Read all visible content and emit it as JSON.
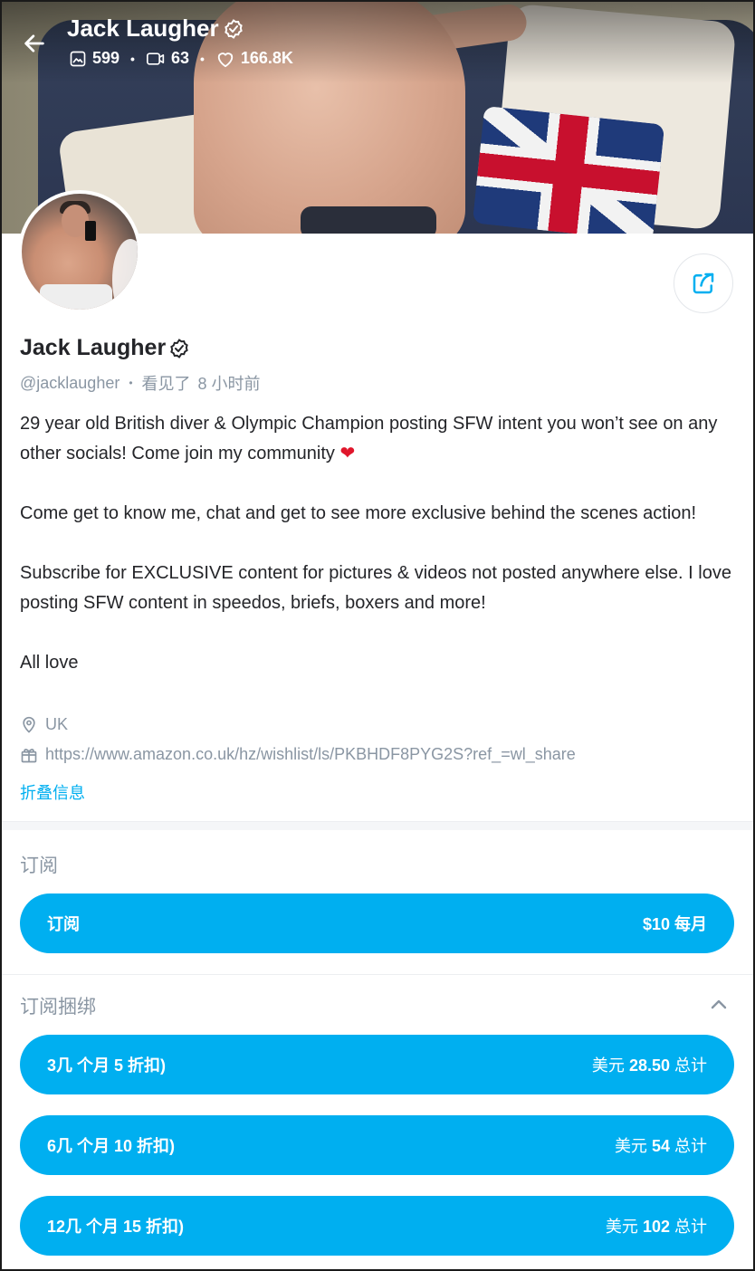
{
  "header": {
    "title": "Jack Laugher",
    "stats": {
      "photos": "599",
      "videos": "63",
      "likes": "166.8K"
    }
  },
  "profile": {
    "name": "Jack Laugher",
    "handle": "@jacklaugher",
    "seen_label": "看见了",
    "seen_time": "8 小时前"
  },
  "bio": {
    "p1": "29 year old British diver & Olympic Champion posting SFW intent you won’t see on any other socials! Come join my community",
    "p2": "Come get to know me, chat and get to see more exclusive behind the scenes action!",
    "p3": "Subscribe for EXCLUSIVE content for pictures & videos not posted anywhere else. I love posting SFW content in speedos, briefs, boxers and more!",
    "p4": "All love",
    "location": "UK",
    "wishlist_url": "https://www.amazon.co.uk/hz/wishlist/ls/PKBHDF8PYG2S?ref_=wl_share",
    "collapse_label": "折叠信息"
  },
  "subscription": {
    "section_label": "订阅",
    "button_label": "订阅",
    "price": "$10",
    "period": "每月"
  },
  "bundles": {
    "section_label": "订阅捆绑",
    "items": [
      {
        "label": "3几 个月 5 折扣)",
        "prefix": "美元",
        "amount": "28.50",
        "suffix": "总计"
      },
      {
        "label": "6几 个月 10 折扣)",
        "prefix": "美元",
        "amount": "54",
        "suffix": "总计"
      },
      {
        "label": "12几 个月 15 折扣)",
        "prefix": "美元",
        "amount": "102",
        "suffix": "总计"
      }
    ]
  },
  "colors": {
    "accent": "#00aff0",
    "muted": "#8a96a3",
    "text": "#242529"
  }
}
